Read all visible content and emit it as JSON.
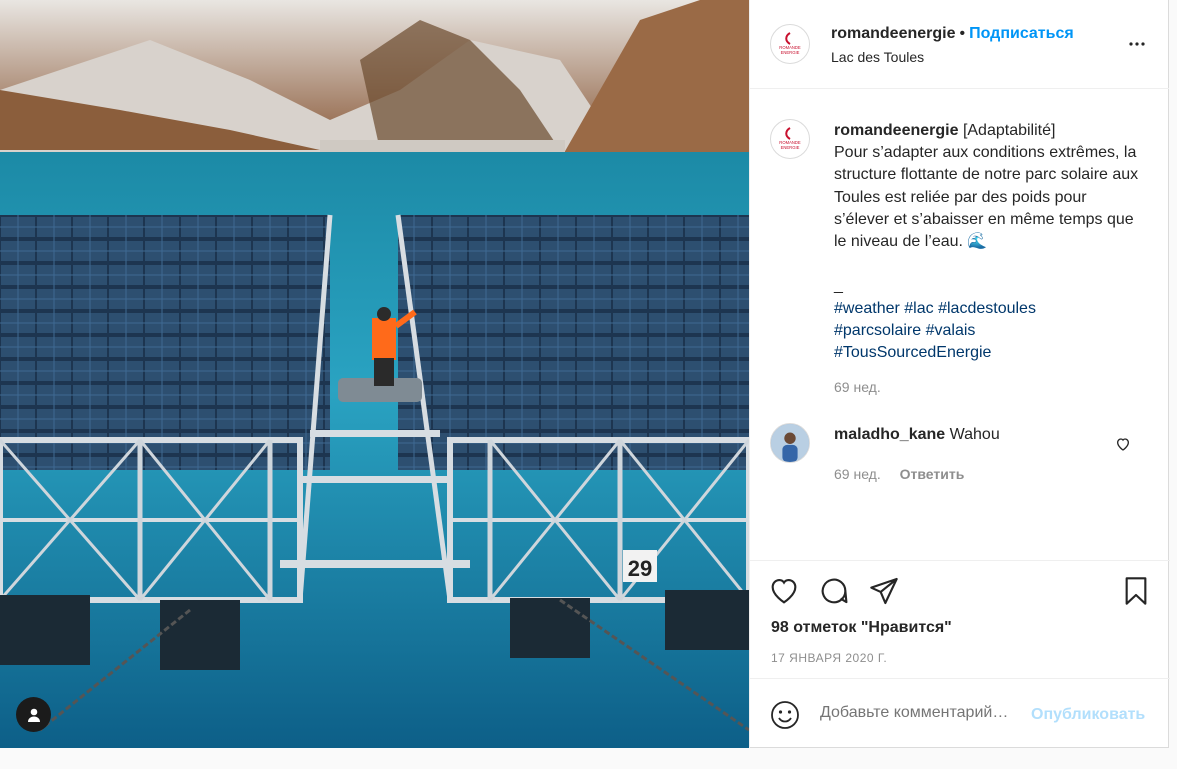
{
  "post": {
    "username": "romandeenergie",
    "dot": "•",
    "follow_label": "Подписаться",
    "location": "Lac des Toules",
    "caption": {
      "username": "romandeenergie",
      "lead": "[Adaptabilité]",
      "text": "Pour s’adapter aux conditions extrêmes, la structure flottante de notre parc solaire aux Toules est reliée par des poids pour s’élever et s’abaisser en même temps que le niveau de l’eau. 🌊",
      "separator": "_",
      "hashtags": [
        "#weather",
        "#lac",
        "#lacdestoules",
        "#parcsolaire",
        "#valais",
        "#TousSourcedEnergie"
      ],
      "time": "69 нед."
    },
    "comments": [
      {
        "username": "maladho_kane",
        "text": "Wahou",
        "time": "69 нед.",
        "reply_label": "Ответить"
      }
    ],
    "likes": "98 отметок \"Нравится\"",
    "date": "17 ЯНВАРЯ 2020 Г.",
    "photo_number": "29",
    "add_comment": {
      "placeholder": "Добавьте комментарий…",
      "publish_label": "Опубликовать"
    }
  },
  "logo_text": [
    "ROMANDE",
    "ENERGIE"
  ],
  "icons": {
    "more": "more-options-icon",
    "like": "heart-icon",
    "comment": "comment-icon",
    "share": "share-icon",
    "save": "bookmark-icon",
    "emoji": "emoji-icon",
    "user_tag": "user-tag-icon"
  },
  "colors": {
    "accent": "#0095f6",
    "hashtag": "#00376b",
    "muted": "#8e8e8e",
    "publish_disabled": "#b2dffc",
    "brand_red": "#c8102e"
  }
}
